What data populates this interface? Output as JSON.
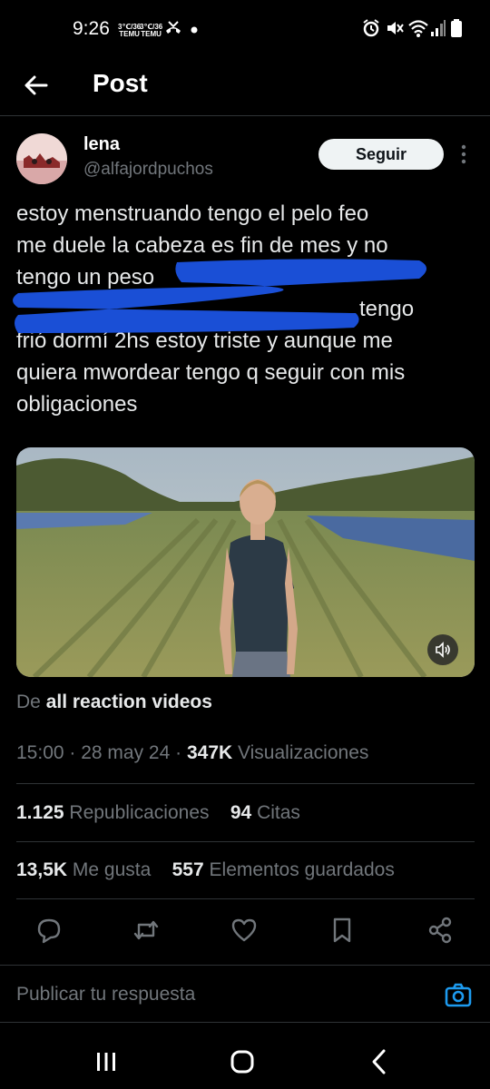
{
  "status_bar": {
    "time": "9:26",
    "mini_badge_1": "3℃/36\nTEMU",
    "mini_badge_2": "3℃/36\nTEMU",
    "icons": [
      "temu-badge-icon",
      "temu-badge-icon",
      "missed-call-icon",
      "dot-icon",
      "alarm-icon",
      "mute-icon",
      "wifi-icon",
      "signal-icon",
      "battery-icon"
    ]
  },
  "header": {
    "title": "Post"
  },
  "post": {
    "author_name": "lena",
    "author_handle": "@alfajordpuchos",
    "follow_label": "Seguir",
    "text_lines": [
      "estoy menstruando tengo el pelo feo",
      "me duele la cabeza es fin de mes y no",
      "tengo un peso",
      "",
      "tengo",
      "frió dormí 2hs estoy triste y aunque me",
      "quiera mwordear tengo q seguir con mis",
      "obligaciones"
    ],
    "source_prefix": "De",
    "source_name": "all reaction videos",
    "time": "15:00",
    "date": "28 may 24",
    "views_count": "347K",
    "views_label": "Visualizaciones",
    "reposts_count": "1.125",
    "reposts_label": "Republicaciones",
    "quotes_count": "94",
    "quotes_label": "Citas",
    "likes_count": "13,5K",
    "likes_label": "Me gusta",
    "bookmarks_count": "557",
    "bookmarks_label": "Elementos guardados"
  },
  "reply": {
    "placeholder": "Publicar tu respuesta"
  },
  "colors": {
    "background": "#000000",
    "text": "#e7e9ea",
    "muted": "#71767b",
    "divider": "#2f3336",
    "accent": "#1d9bf0",
    "redaction": "#1a4fd6"
  }
}
